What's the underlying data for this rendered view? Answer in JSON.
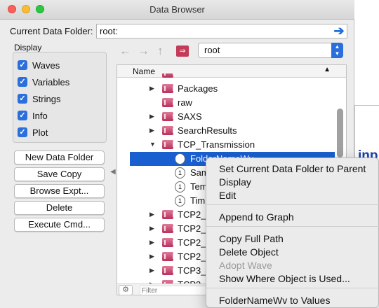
{
  "window": {
    "title": "Data Browser"
  },
  "current_folder": {
    "label": "Current Data Folder:",
    "value": "root:"
  },
  "display": {
    "label": "Display",
    "options": [
      {
        "label": "Waves",
        "checked": true
      },
      {
        "label": "Variables",
        "checked": true
      },
      {
        "label": "Strings",
        "checked": true
      },
      {
        "label": "Info",
        "checked": true
      },
      {
        "label": "Plot",
        "checked": true
      }
    ]
  },
  "buttons": {
    "new_folder": "New Data Folder",
    "save_copy": "Save Copy",
    "browse": "Browse Expt...",
    "delete": "Delete",
    "execute": "Execute Cmd..."
  },
  "browser": {
    "folder_select": "root",
    "column_name": "Name",
    "filter_placeholder": "Filter",
    "items": [
      {
        "label": "Packages",
        "type": "folder",
        "expander": true
      },
      {
        "label": "raw",
        "type": "folder",
        "expander": false
      },
      {
        "label": "SAXS",
        "type": "folder",
        "expander": true
      },
      {
        "label": "SearchResults",
        "type": "folder",
        "expander": true
      },
      {
        "label": "TCP_Transmission",
        "type": "folder",
        "expander": true,
        "expanded": true
      },
      {
        "label": "FolderNameWv",
        "type": "wave",
        "selected": true
      },
      {
        "label": "Sam",
        "type": "wave"
      },
      {
        "label": "Tem",
        "type": "wave"
      },
      {
        "label": "Tim",
        "type": "wave"
      },
      {
        "label": "TCP2_",
        "type": "folder",
        "expander": true
      },
      {
        "label": "TCP2_",
        "type": "folder",
        "expander": true
      },
      {
        "label": "TCP2_",
        "type": "folder",
        "expander": true
      },
      {
        "label": "TCP2_",
        "type": "folder",
        "expander": true
      },
      {
        "label": "TCP3_",
        "type": "folder",
        "expander": true
      },
      {
        "label": "TCP3_",
        "type": "folder",
        "expander": true
      }
    ]
  },
  "context_menu": {
    "items": [
      {
        "label": "Set Current Data Folder to Parent",
        "disabled": false
      },
      {
        "label": "Display",
        "disabled": false
      },
      {
        "label": "Edit",
        "disabled": false
      },
      {
        "label": "Append to Graph",
        "disabled": false
      },
      {
        "label": "Copy Full Path",
        "disabled": false
      },
      {
        "label": "Delete Object",
        "disabled": false
      },
      {
        "label": "Adopt Wave",
        "disabled": true
      },
      {
        "label": "Show Where Object is Used...",
        "disabled": false
      },
      {
        "label": "FolderNameWv to Values",
        "disabled": false
      }
    ]
  },
  "background": {
    "partial_text": "inp"
  }
}
